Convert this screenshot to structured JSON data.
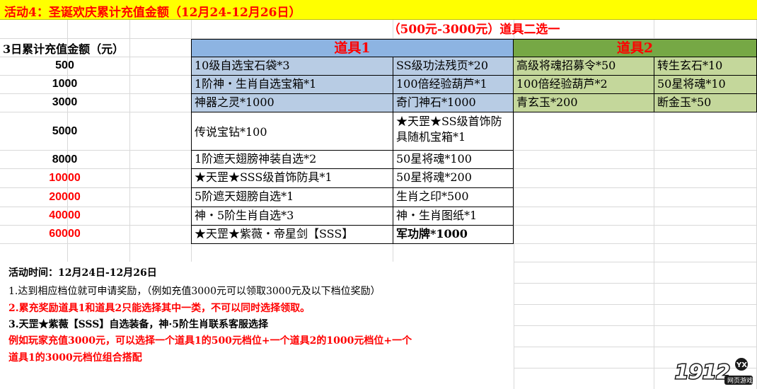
{
  "title": "活动4：圣诞欢庆累计充值金额（12月24-12月26日）",
  "subtitle": "（500元-3000元）道具二选一",
  "amount_header": "3日累计充值金额（元）",
  "item1_header": "道具1",
  "item2_header": "道具2",
  "rows": [
    {
      "amount": "500",
      "a": "10级自选宝石袋*3",
      "b": "SS级功法残页*20",
      "c": "高级将魂招募令*50",
      "d": "转生玄石*10"
    },
    {
      "amount": "1000",
      "a": "1阶神・生肖自选宝箱*1",
      "b": "100倍经验葫芦*1",
      "c": "100倍经验葫芦*2",
      "d": "50星将魂*10"
    },
    {
      "amount": "3000",
      "a": "神器之灵*1000",
      "b": "奇门神石*1000",
      "c": "青玄玉*200",
      "d": "断金玉*50"
    },
    {
      "amount": "5000",
      "a": "传说宝钻*100",
      "b": "★天罡★SS级首饰防具随机宝箱*1"
    },
    {
      "amount": "8000",
      "a": "1阶遮天翅膀神装自选*2",
      "b": "50星将魂*100"
    },
    {
      "amount": "10000",
      "a": "★天罡★SSS级首饰防具*1",
      "b": "50星将魂*200"
    },
    {
      "amount": "20000",
      "a": "5阶遮天翅膀自选*1",
      "b": "生肖之印*500"
    },
    {
      "amount": "40000",
      "a": "神・5阶生肖自选*3",
      "b": "神・生肖图纸*1"
    },
    {
      "amount": "60000",
      "a": "★天罡★紫薇・帝星剑【SSS】",
      "b": "军功牌*1000"
    }
  ],
  "notes": {
    "time": "活动时间：12月24日-12月26日",
    "line1": "1.达到相应档位就可申请奖励，（例如充值3000元可以领取3000元及以下档位奖励）",
    "line2": "2.累充奖励道具1和道具2只能选择其中一类，不可以同时选择领取。",
    "line3": "3.天罡★紫薇【SSS】自选装备，神·5阶生肖联系客服选择",
    "line4": "例如玩家充值3000元，可以选择一个道具1的500元档位+一个道具2的1000元档位+一个",
    "line5": "道具1的3000元档位组合搭配"
  },
  "logo": {
    "number": "1912",
    "badge": "YX",
    "tagline": "网页游戏"
  },
  "colors": {
    "title_bg": "#ffff00",
    "red": "#ff0000",
    "blue_header": "#8db4e2",
    "blue_cell": "#b8cce4",
    "green_header": "#76a845",
    "green_cell": "#c4d79b"
  }
}
